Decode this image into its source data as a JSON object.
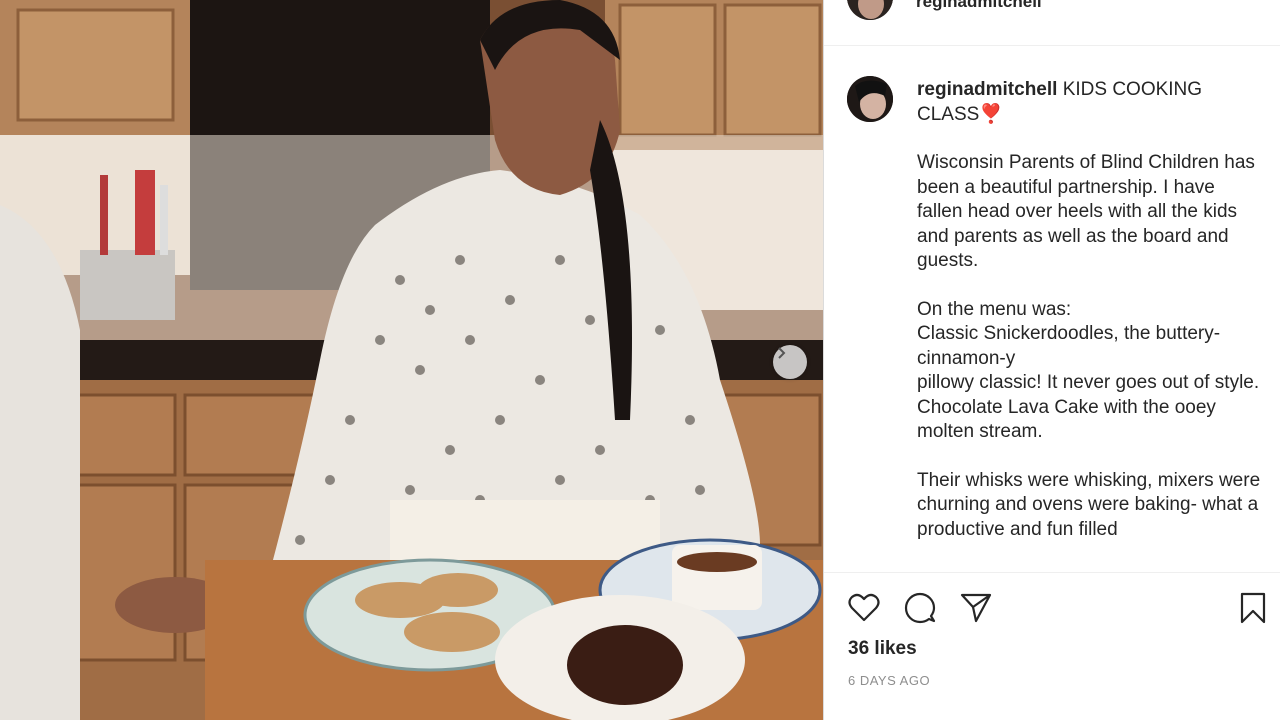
{
  "post": {
    "username": "reginadmitchell",
    "caption_title": "KIDS COOKING CLASS❣️",
    "caption_paragraphs": [
      "Wisconsin Parents of Blind Children has been a beautiful partnership. I have fallen head over heels with all the kids and parents as well as the board and guests.",
      "On the menu was:\nClassic Snickerdoodles, the buttery-cinnamon-y\npillowy classic! It never goes out of style.\nChocolate Lava Cake with the ooey molten stream.",
      "Their whisks were whisking, mixers were churning and ovens were baking- what a productive and fun filled"
    ],
    "likes": "36 likes",
    "date": "6 DAYS AGO"
  },
  "icons": {
    "like": "heart-icon",
    "comment": "comment-icon",
    "share": "paper-plane-icon",
    "save": "bookmark-icon",
    "next": "chevron-right-icon"
  },
  "colors": {
    "text": "#262626",
    "muted": "#8e8e8e",
    "border": "#dbdbdb"
  }
}
